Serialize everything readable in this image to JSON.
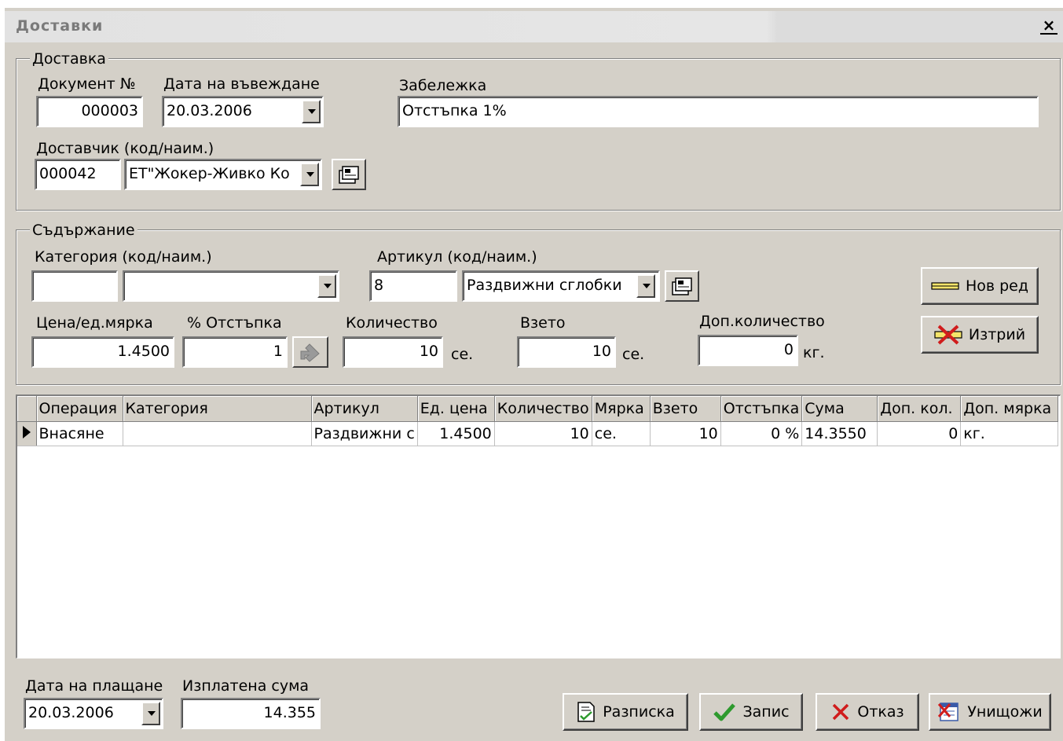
{
  "window": {
    "title": "Доставки",
    "close": "×"
  },
  "delivery": {
    "group_title": "Доставка",
    "doc_label": "Документ №",
    "doc_value": "000003",
    "date_label": "Дата на въвеждане",
    "date_value": "20.03.2006",
    "note_label": "Забележка",
    "note_value": "Отстъпка 1%",
    "supplier_label": "Доставчик (код/наим.)",
    "supplier_code": "000042",
    "supplier_name": "ЕТ\"Жокер-Живко Ко"
  },
  "content": {
    "group_title": "Съдържание",
    "category_label": "Категория (код/наим.)",
    "category_code": "",
    "category_name": "",
    "article_label": "Артикул (код/наим.)",
    "article_code": "8",
    "article_name": "Раздвижни сглобки",
    "price_label": "Цена/ед.мярка",
    "price_value": "1.4500",
    "discount_label": "% Отстъпка",
    "discount_value": "1",
    "qty_label": "Количество",
    "qty_value": "10",
    "qty_unit": "се.",
    "taken_label": "Взето",
    "taken_value": "10",
    "taken_unit": "се.",
    "addqty_label": "Доп.количество",
    "addqty_value": "0",
    "addqty_unit": "кг.",
    "new_row_label": "Нов ред",
    "delete_label": "Изтрий"
  },
  "grid": {
    "columns": [
      "Операция",
      "Категория",
      "Артикул",
      "Ед. цена",
      "Количество",
      "Мярка",
      "Взето",
      "Отстъпка",
      "Сума",
      "Доп. кол.",
      "Доп. мярка"
    ],
    "rows": [
      [
        "Внасяне",
        "",
        "Раздвижни с",
        "1.4500",
        "10",
        "се.",
        "10",
        "0 %",
        "14.3550",
        "0",
        "кг."
      ]
    ]
  },
  "footer": {
    "paydate_label": "Дата на плащане",
    "paydate_value": "20.03.2006",
    "paid_label": "Изплатена сума",
    "paid_value": "14.355",
    "receipt_label": "Разписка",
    "save_label": "Запис",
    "cancel_label": "Отказ",
    "destroy_label": "Унищожи"
  },
  "colors": {
    "face": "#d4d0c8",
    "check_green": "#2e9a2e",
    "cross_red": "#d01c1c"
  }
}
